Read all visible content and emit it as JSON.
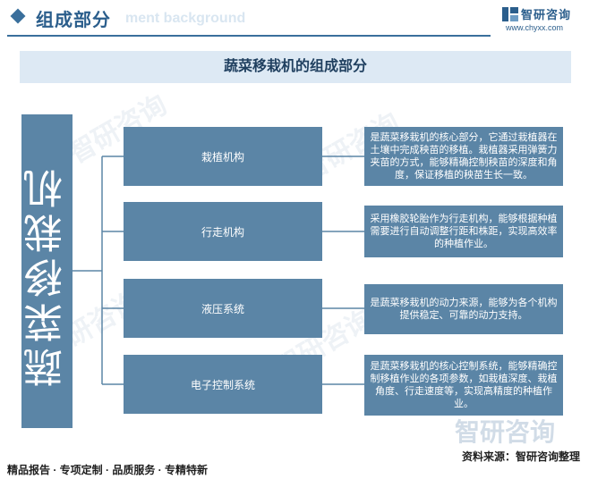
{
  "header": {
    "section_title": "组成部分",
    "bg_text": "ment background",
    "logo_name": "智研咨询",
    "logo_url": "www.chyxx.com"
  },
  "title": "蔬菜移栽机的组成部分",
  "side_label": "蔬菜移栽机",
  "items": [
    {
      "name": "栽植机构",
      "description": "是蔬菜移栽机的核心部分，它通过栽植器在土壤中完成秧苗的移植。栽植器采用弹簧力夹苗的方式，能够精确控制秧苗的深度和角度，保证移植的秧苗生长一致。"
    },
    {
      "name": "行走机构",
      "description": "采用橡胶轮胎作为行走机构，能够根据种植需要进行自动调整行距和株距，实现高效率的种植作业。"
    },
    {
      "name": "液压系统",
      "description": "是蔬菜移栽机的动力来源，能够为各个机构提供稳定、可靠的动力支持。"
    },
    {
      "name": "电子控制系统",
      "description": "是蔬菜移栽机的核心控制系统，能够精确控制移植作业的各项参数，如栽植深度、栽植角度、行走速度等，实现高精度的种植作业。"
    }
  ],
  "footer": {
    "left": "精品报告 · 专项定制 · 品质服务 · 专精特新",
    "right": "资料来源：智研咨询整理",
    "watermark": "智研咨询"
  },
  "colors": {
    "box": "#5b85a6",
    "title_bg": "#dde9f4",
    "accent": "#2b5e8c",
    "connector": "#5b85a6"
  }
}
